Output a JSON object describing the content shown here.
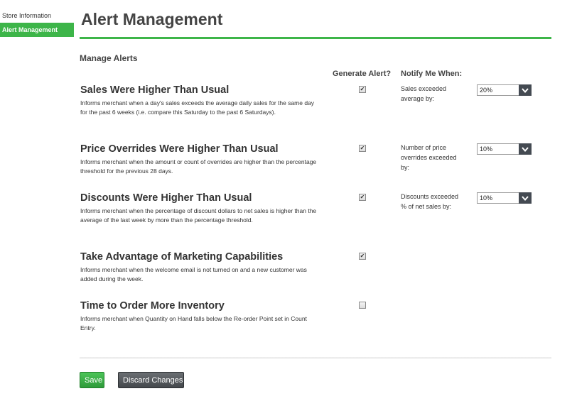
{
  "sidebar": {
    "items": [
      {
        "label": "Store Information",
        "active": false
      },
      {
        "label": "Alert Management",
        "active": true
      }
    ]
  },
  "page": {
    "title": "Alert Management",
    "section_title": "Manage Alerts",
    "col_generate": "Generate Alert?",
    "col_notify": "Notify Me When:"
  },
  "alerts": [
    {
      "title": "Sales Were Higher Than Usual",
      "description": "Informs merchant when a day's sales exceeds the average daily sales for the same day for the past 6 weeks (i.e. compare this Saturday to the past 6 Saturdays).",
      "checked": true,
      "notify_label": "Sales exceeded average by:",
      "dropdown_value": "20%"
    },
    {
      "title": "Price Overrides Were Higher Than Usual",
      "description": "Informs merchant when the amount or count of overrides are higher than the percentage threshold for the previous 28 days.",
      "checked": true,
      "notify_label": "Number of price overrides exceeded by:",
      "dropdown_value": "10%"
    },
    {
      "title": "Discounts Were Higher Than Usual",
      "description": "Informs merchant when the percentage of discount dollars to net sales is higher than the average of the last week by more than the percentage threshold.",
      "checked": true,
      "notify_label": "Discounts exceeded % of net sales by:",
      "dropdown_value": "10%"
    },
    {
      "title": "Take Advantage of Marketing Capabilities",
      "description": "Informs merchant when the welcome email is not turned on and a new customer was added during the week.",
      "checked": true
    },
    {
      "title": "Time to Order More Inventory",
      "description": "Informs merchant when Quantity on Hand falls below the Re-order Point set in Count Entry.",
      "checked": false
    }
  ],
  "buttons": {
    "save": "Save",
    "discard": "Discard Changes"
  },
  "icons": {
    "checkmark": "check-icon",
    "dropdown": "chevron-down-icon"
  },
  "colors": {
    "accent": "#3db549",
    "discard_button": "#44484c"
  }
}
